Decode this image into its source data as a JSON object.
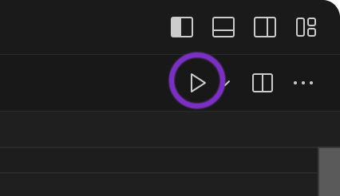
{
  "layout_controls": {
    "buttons": [
      {
        "icon": "toggle-primary-sidebar-icon"
      },
      {
        "icon": "toggle-panel-icon"
      },
      {
        "icon": "toggle-secondary-sidebar-icon"
      },
      {
        "icon": "customize-layout-icon"
      }
    ]
  },
  "editor_actions": {
    "run_icon": "play-icon",
    "run_dropdown_icon": "chevron-down-icon",
    "split_icon": "split-editor-icon",
    "more_icon": "more-actions-icon"
  },
  "colors": {
    "background": "#1f1f1f",
    "titlebar": "#1a1a1a",
    "icon": "#cccccc",
    "highlight": "#7c2fc7"
  }
}
